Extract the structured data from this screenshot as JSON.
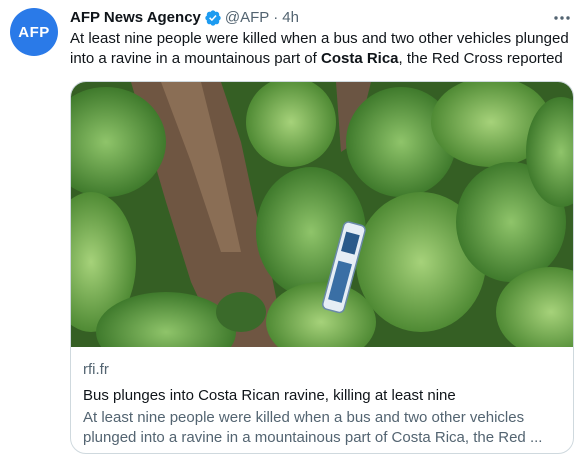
{
  "avatar": {
    "text": "AFP",
    "color": "#2a7ae8"
  },
  "author": {
    "name": "AFP News Agency",
    "handle": "@AFP",
    "separator": "·",
    "time": "4h",
    "verified_icon": "verified-badge-icon",
    "verified_color": "#1d9bf0"
  },
  "tweet": {
    "text_before": "At least nine people were killed when a bus and two other vehicles plunged into a ravine in a mountainous part of ",
    "text_bold": "Costa Rica",
    "text_after": ", the Red Cross reported"
  },
  "card": {
    "domain": "rfi.fr",
    "title": "Bus plunges into Costa Rican ravine, killing at least nine",
    "description_line1": "At least nine people were killed when a bus and two other vehicles",
    "description_line2": "plunged into a ravine in a mountainous part of Costa Rica, the Red ..."
  },
  "icons": {
    "more": "more-options-icon"
  }
}
